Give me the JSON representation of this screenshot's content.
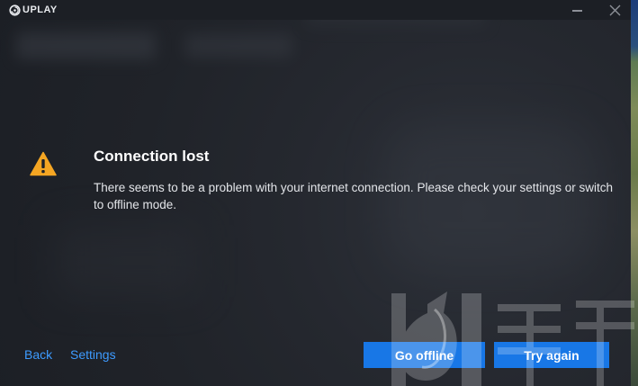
{
  "app": {
    "logo_text": "UPLAY"
  },
  "titlebar": {
    "minimize_icon": "minimize-icon",
    "close_icon": "close-icon"
  },
  "dialog": {
    "icon": "warning-icon",
    "icon_color": "#f5a623",
    "title": "Connection lost",
    "message": "There seems to be a problem with your internet connection. Please check your settings or switch to offline mode."
  },
  "footer": {
    "back_label": "Back",
    "settings_label": "Settings",
    "go_offline_label": "Go offline",
    "try_again_label": "Try again"
  },
  "colors": {
    "accent": "#1877e6",
    "link": "#3d9bff",
    "background": "#1f2228",
    "warning": "#f5a623"
  }
}
